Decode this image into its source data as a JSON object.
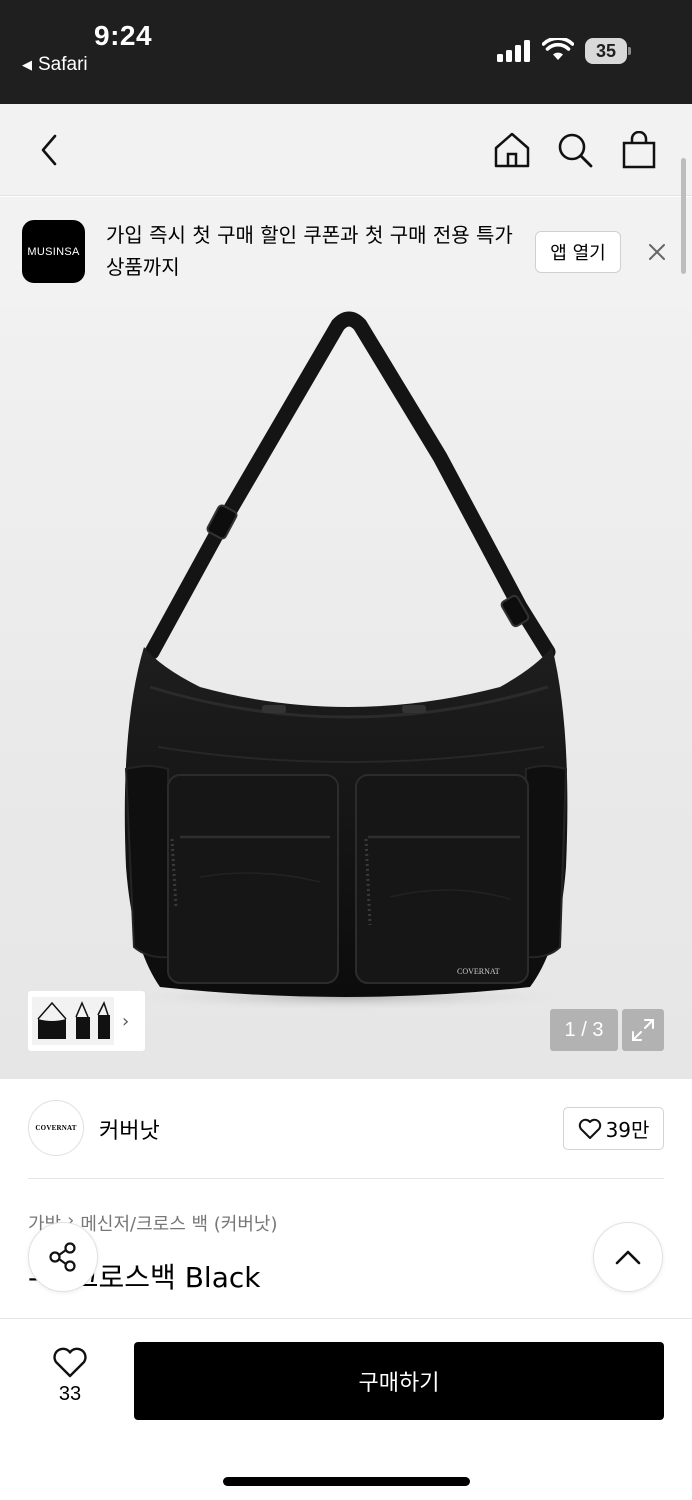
{
  "status_bar": {
    "time": "9:24",
    "back_app": "Safari",
    "battery": "35"
  },
  "nav": {
    "icons": [
      "back-icon",
      "home-icon",
      "search-icon",
      "shopping-bag-icon"
    ]
  },
  "banner": {
    "logo_text": "MUSINSA",
    "text": "가입 즉시 첫 구매 할인 쿠폰과 첫 구매 전용 특가 상품까지",
    "open_button": "앱 열기"
  },
  "gallery": {
    "brand_mark_on_product": "COVERNAT",
    "page_indicator": "1 / 3",
    "thumbnail_count": 3
  },
  "brand": {
    "logo_text": "COVERNAT",
    "name": "커버낫",
    "likes": "39만"
  },
  "product": {
    "breadcrumb": [
      "가방",
      "메신저/크로스 백 (커버낫)"
    ],
    "title": "-ㅏ 크로스백 Black"
  },
  "bottom_bar": {
    "wish_count": "33",
    "buy_label": "구매하기"
  }
}
